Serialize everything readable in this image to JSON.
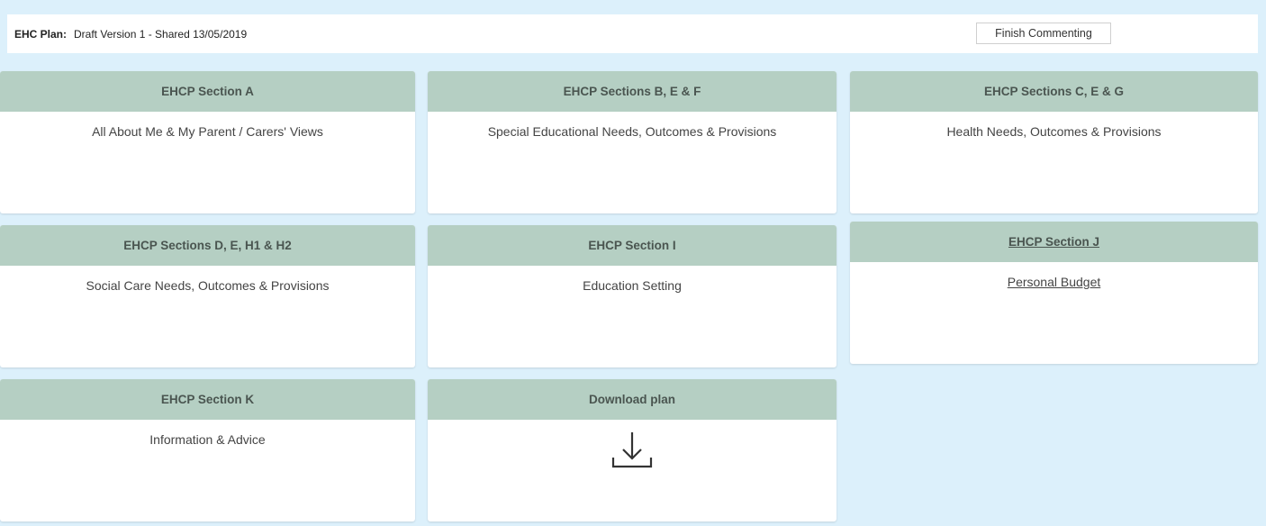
{
  "header": {
    "plan_label": "EHC Plan:",
    "plan_value": "Draft Version 1 - Shared 13/05/2019",
    "finish_label": "Finish Commenting"
  },
  "cards": [
    {
      "title": "EHCP Section A",
      "body": "All About Me & My Parent / Carers' Views"
    },
    {
      "title": "EHCP Sections B, E & F",
      "body": "Special Educational Needs, Outcomes & Provisions"
    },
    {
      "title": "EHCP Sections C, E & G",
      "body": "Health Needs, Outcomes & Provisions"
    },
    {
      "title": "EHCP Sections D, E, H1 & H2",
      "body": "Social Care Needs, Outcomes & Provisions"
    },
    {
      "title": "EHCP Section I",
      "body": "Education Setting"
    },
    {
      "title": "EHCP Section J",
      "body": "Personal Budget"
    },
    {
      "title": "EHCP Section K",
      "body": "Information & Advice"
    },
    {
      "title": "Download plan",
      "icon": "download-icon"
    }
  ],
  "colors": {
    "background": "#dcf0fb",
    "card_header": "#b5cfc3",
    "card_body": "#ffffff"
  }
}
